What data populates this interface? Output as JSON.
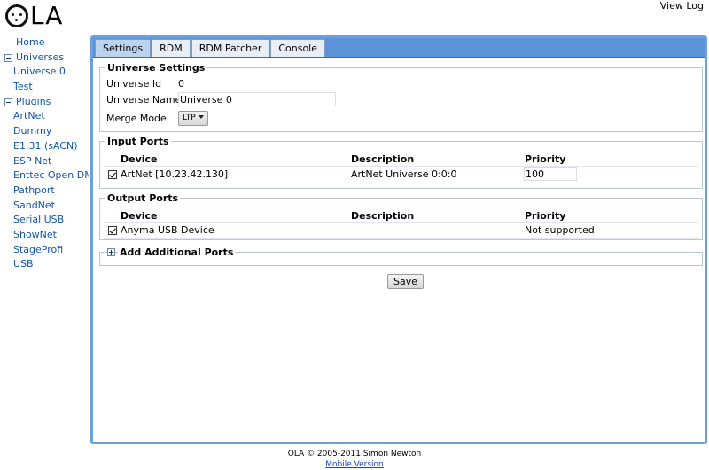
{
  "header": {
    "logo_text": "LA",
    "view_log": "View Log"
  },
  "sidebar": {
    "home": "Home",
    "universes_label": "Universes",
    "universes": [
      "Universe 0",
      "Test"
    ],
    "plugins_label": "Plugins",
    "plugins": [
      "ArtNet",
      "Dummy",
      "E1.31 (sACN)",
      "ESP Net",
      "Enttec Open DMX",
      "Pathport",
      "SandNet",
      "Serial USB",
      "ShowNet",
      "StageProfi",
      "USB"
    ]
  },
  "tabs": [
    "Settings",
    "RDM",
    "RDM Patcher",
    "Console"
  ],
  "universe_settings": {
    "title": "Universe Settings",
    "id_label": "Universe Id",
    "id_value": "0",
    "name_label": "Universe Name",
    "name_value": "Universe 0",
    "merge_label": "Merge Mode",
    "merge_value": "LTP"
  },
  "input_ports": {
    "title": "Input Ports",
    "headers": [
      "Device",
      "Description",
      "Priority"
    ],
    "rows": [
      {
        "device": "ArtNet [10.23.42.130]",
        "description": "ArtNet Universe 0:0:0",
        "priority": "100",
        "checked": true
      }
    ]
  },
  "output_ports": {
    "title": "Output Ports",
    "headers": [
      "Device",
      "Description",
      "Priority"
    ],
    "rows": [
      {
        "device": "Anyma USB Device",
        "description": "",
        "priority": "Not supported",
        "checked": true
      }
    ]
  },
  "add_ports": {
    "title": "Add Additional Ports"
  },
  "save_label": "Save",
  "footer": {
    "copyright": "OLA © 2005-2011 Simon Newton",
    "mobile_link": "Mobile Version"
  },
  "colors": {
    "accent": "#5b93d6",
    "link": "#1155aa",
    "panel_border": "#6a9fe0"
  }
}
